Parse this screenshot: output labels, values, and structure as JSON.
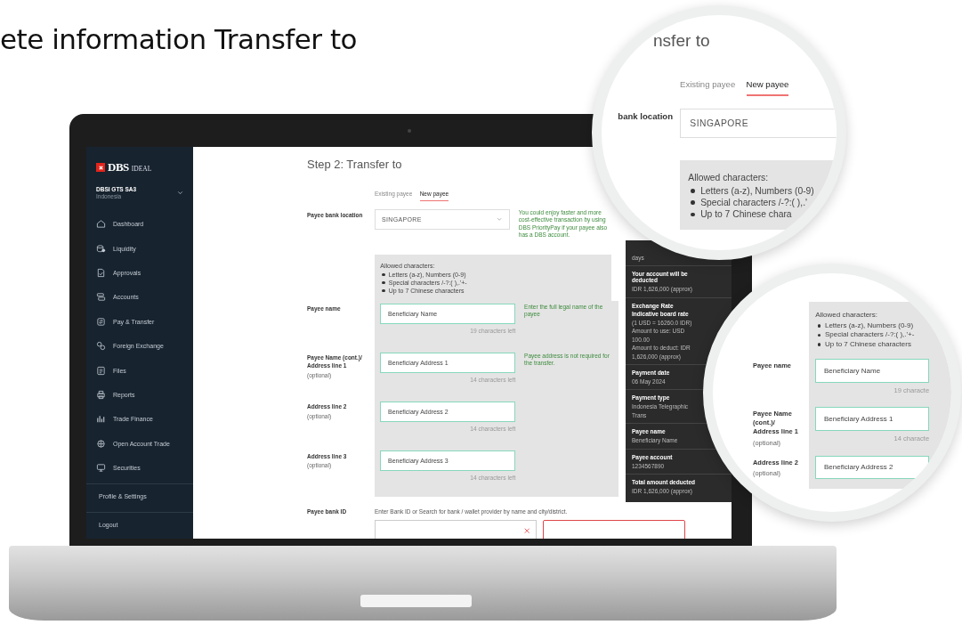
{
  "heading": "ete information Transfer to",
  "sidebar": {
    "brand": "DBS",
    "product": "IDEAL",
    "account": "DBSI GTS SA3",
    "country": "Indonesia",
    "items": [
      {
        "label": "Dashboard",
        "selected": false
      },
      {
        "label": "Liquidity",
        "selected": false
      },
      {
        "label": "Approvals",
        "selected": false
      },
      {
        "label": "Accounts",
        "selected": false
      },
      {
        "label": "Pay & Transfer",
        "selected": false
      },
      {
        "label": "Foreign Exchange",
        "selected": false
      },
      {
        "label": "Files",
        "selected": false
      },
      {
        "label": "Reports",
        "selected": false
      },
      {
        "label": "Trade Finance",
        "selected": false
      },
      {
        "label": "Open Account Trade",
        "selected": false
      },
      {
        "label": "Securities",
        "selected": false
      }
    ],
    "footer_items": [
      "Profile & Settings",
      "Logout"
    ]
  },
  "form": {
    "parts": [
      {
        "kind": "heading",
        "text": "Step 2: Transfer to"
      },
      {
        "kind": "tabs",
        "tabs": [
          {
            "label": "Existing payee",
            "selected": false
          },
          {
            "label": "New payee",
            "selected": true
          }
        ]
      },
      {
        "kind": "select",
        "label": "Payee bank location",
        "value": "SINGAPORE",
        "tip": "You could enjoy faster and more cost-effective transaction by using DBS PriorityPay if your payee also has a DBS account."
      },
      {
        "kind": "group",
        "title": "Allowed characters:",
        "items": [
          "Letters (a-z), Numbers (0-9)",
          "Special characters /-?:( ),.'+-",
          "Up to 7 Chinese characters"
        ],
        "fields": [
          {
            "label": "Payee name",
            "value": "Beneficiary Name",
            "counter": "19 characters left",
            "tip": "Enter the full legal name of the payee"
          },
          {
            "label": "Payee Name (cont.)/ Address line 1",
            "note": "(optional)",
            "value": "Beneficiary Address 1",
            "counter": "14 characters left",
            "tip": "Payee address is not required for the transfer."
          },
          {
            "label": "Address line 2",
            "note": "(optional)",
            "value": "Beneficiary Address 2",
            "counter": "14 characters left"
          },
          {
            "label": "Address line 3",
            "note": "(optional)",
            "value": "Beneficiary Address 3",
            "counter": "14 characters left"
          }
        ]
      },
      {
        "kind": "search",
        "label": "Payee bank ID",
        "hint": "Enter Bank ID or Search for bank / wallet provider by name and city/district."
      }
    ]
  },
  "summary": {
    "sections": [
      [
        {
          "kind": "value",
          "text": "days"
        }
      ],
      [
        {
          "kind": "label",
          "text": "Your account will be deducted"
        },
        {
          "kind": "value",
          "text": "IDR 1,626,000 (approx)"
        }
      ],
      [
        {
          "kind": "label",
          "text": "Exchange Rate"
        },
        {
          "kind": "label",
          "text": "Indicative board rate"
        },
        {
          "kind": "value",
          "text": "(1 USD = 16260.0 IDR)"
        },
        {
          "kind": "value",
          "text": "Amount to use: USD 100.00"
        },
        {
          "kind": "value",
          "text": "Amount to deduct: IDR 1,626,000 (approx)"
        }
      ],
      [
        {
          "kind": "label",
          "text": "Payment date"
        },
        {
          "kind": "value",
          "text": "06 May 2024"
        }
      ],
      [
        {
          "kind": "label",
          "text": "Payment type"
        },
        {
          "kind": "value",
          "text": "Indonesia Telegraphic Trans"
        }
      ],
      [
        {
          "kind": "label",
          "text": "Payee name"
        },
        {
          "kind": "value",
          "text": "Beneficiary Name"
        }
      ],
      [
        {
          "kind": "label",
          "text": "Payee account"
        },
        {
          "kind": "value",
          "text": "1234567890"
        }
      ],
      [
        {
          "kind": "label",
          "text": "Total amount deducted"
        },
        {
          "kind": "value",
          "text": "IDR 1,626,000 (approx)"
        }
      ]
    ]
  },
  "magnifiers": [
    {
      "parts": [
        {
          "kind": "heading",
          "text": "nsfer to"
        },
        {
          "kind": "tabs",
          "tabs": [
            {
              "label": "Existing payee",
              "selected": false
            },
            {
              "label": "New payee",
              "selected": true
            }
          ]
        },
        {
          "kind": "select",
          "label": "bank location",
          "value": "SINGAPORE"
        },
        {
          "kind": "group",
          "title": "Allowed characters:",
          "items": [
            "Letters (a-z), Numbers (0-9)",
            "Special characters /-?:( ),.'",
            "Up to 7 Chinese chara"
          ]
        }
      ]
    },
    {
      "parts": [
        {
          "kind": "group",
          "title": "Allowed characters:",
          "items": [
            "Letters (a-z), Numbers (0-9)",
            "Special characters /-?:( ),.'+-",
            "Up to 7 Chinese characters"
          ],
          "fields": [
            {
              "label": "Payee name",
              "value": "Beneficiary Name",
              "counter": "19 characte"
            },
            {
              "label": "Payee Name (cont.)/ Address line 1",
              "note": "(optional)",
              "value": "Beneficiary Address 1",
              "counter": "14 characte"
            },
            {
              "label": "Address line 2",
              "note": "(optional)",
              "value": "Beneficiary Address 2"
            }
          ]
        }
      ]
    }
  ]
}
